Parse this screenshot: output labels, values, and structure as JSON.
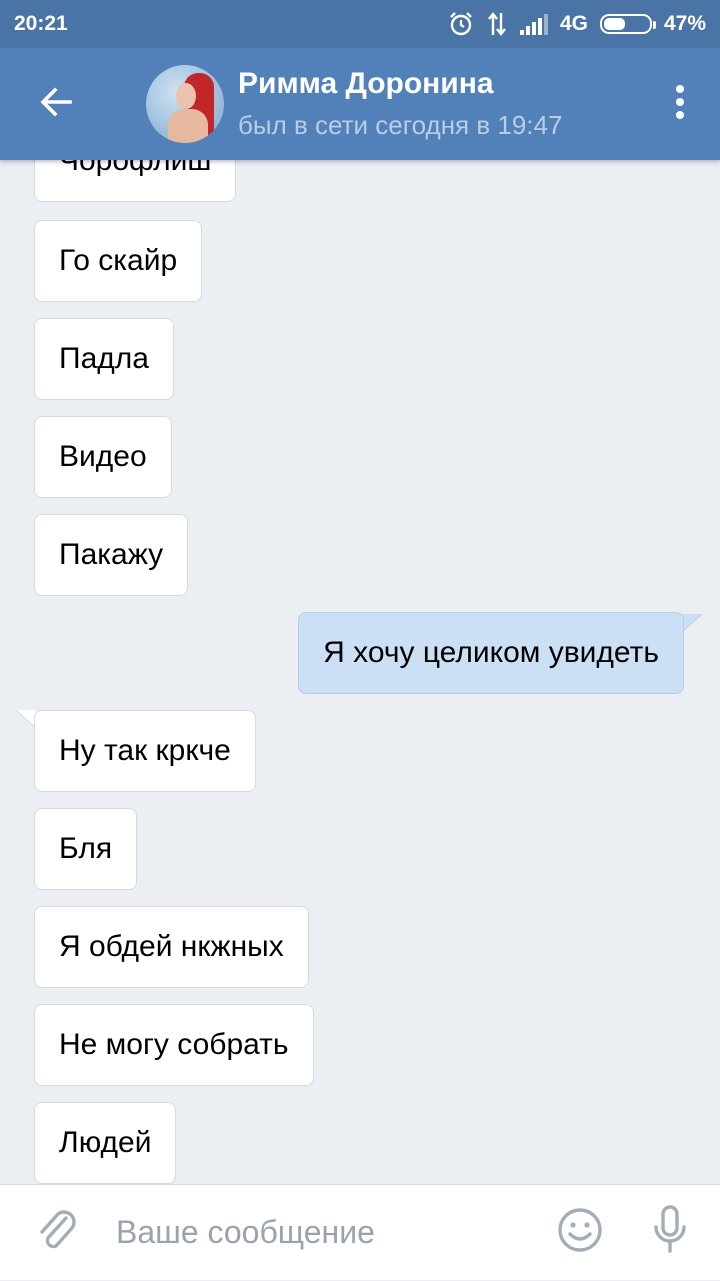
{
  "status_bar": {
    "time": "20:21",
    "network": "4G",
    "battery_text": "47%",
    "battery_level": 0.47
  },
  "header": {
    "contact_name": "Римма Доронина",
    "contact_status": "был в сети сегодня в 19:47",
    "accent_color": "#5181b8"
  },
  "messages": [
    {
      "text": "Чорофлиш",
      "direction": "incoming"
    },
    {
      "text": "Го скайр",
      "direction": "incoming"
    },
    {
      "text": "Падла",
      "direction": "incoming"
    },
    {
      "text": "Видео",
      "direction": "incoming"
    },
    {
      "text": "Пакажу",
      "direction": "incoming"
    },
    {
      "text": "Я хочу целиком увидеть",
      "direction": "outgoing"
    },
    {
      "text": "Ну так кркче",
      "direction": "incoming"
    },
    {
      "text": "Бля",
      "direction": "incoming"
    },
    {
      "text": "Я обдей нкжных",
      "direction": "incoming"
    },
    {
      "text": "Не могу собрать",
      "direction": "incoming"
    },
    {
      "text": "Людей",
      "direction": "incoming"
    }
  ],
  "input": {
    "placeholder": "Ваше сообщение",
    "value": ""
  },
  "icons": {
    "back": "arrow-left-icon",
    "more": "more-vertical-icon",
    "attach": "paperclip-icon",
    "emoji": "smile-icon",
    "mic": "microphone-icon"
  }
}
